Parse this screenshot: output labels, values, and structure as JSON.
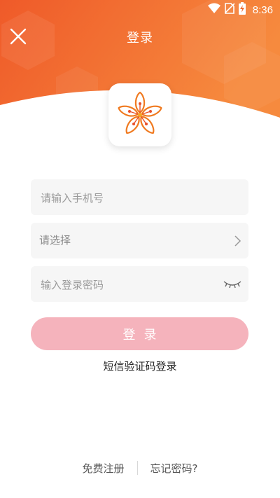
{
  "status_bar": {
    "time": "8:36",
    "icons": [
      "wifi-icon",
      "no-sim-icon",
      "battery-charging-icon"
    ]
  },
  "header": {
    "title": "登录",
    "close_icon": "close-icon",
    "gradient_colors": [
      "#f05a2a",
      "#f5873f"
    ]
  },
  "logo": {
    "icon": "plum-blossom-logo",
    "color": "#f07a20"
  },
  "form": {
    "phone_placeholder": "请输入手机号",
    "select_label": "请选择",
    "select_icon": "chevron-right-icon",
    "password_placeholder": "输入登录密码",
    "password_icon": "eye-closed-icon"
  },
  "login_button": {
    "label": "登录",
    "color": "#f5b3bc"
  },
  "sms_login_label": "短信验证码登录",
  "footer": {
    "register_label": "免费注册",
    "forgot_label": "忘记密码?"
  }
}
